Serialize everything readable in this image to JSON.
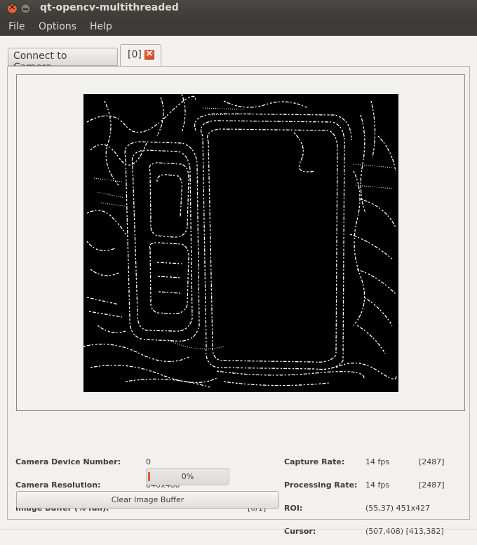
{
  "window": {
    "title": "qt-opencv-multithreaded"
  },
  "menu": {
    "file": "File",
    "options": "Options",
    "help": "Help"
  },
  "tabs": {
    "connect_label": "Connect to Camera...",
    "camera_label": "[0]"
  },
  "info": {
    "device_number_label": "Camera Device Number:",
    "device_number_value": "0",
    "resolution_label": "Camera Resolution:",
    "resolution_value": "640x480",
    "buffer_label": "Image Buffer (% full):",
    "buffer_percent_text": "0%",
    "buffer_fill_fraction": 0.02,
    "buffer_count": "[0/1]",
    "clear_button_label": "Clear Image Buffer",
    "capture_rate_label": "Capture Rate:",
    "capture_rate_value": "14 fps",
    "capture_rate_frames": "[2487]",
    "processing_rate_label": "Processing Rate:",
    "processing_rate_value": "14 fps",
    "processing_rate_frames": "[2487]",
    "roi_label": "ROI:",
    "roi_value": "(55,37) 451x427",
    "cursor_label": "Cursor:",
    "cursor_value": "(507,408) [413,382]"
  },
  "colors": {
    "accent": "#e05a2c",
    "titlebar": "#3c3b37",
    "window_bg": "#f2f1f0"
  }
}
